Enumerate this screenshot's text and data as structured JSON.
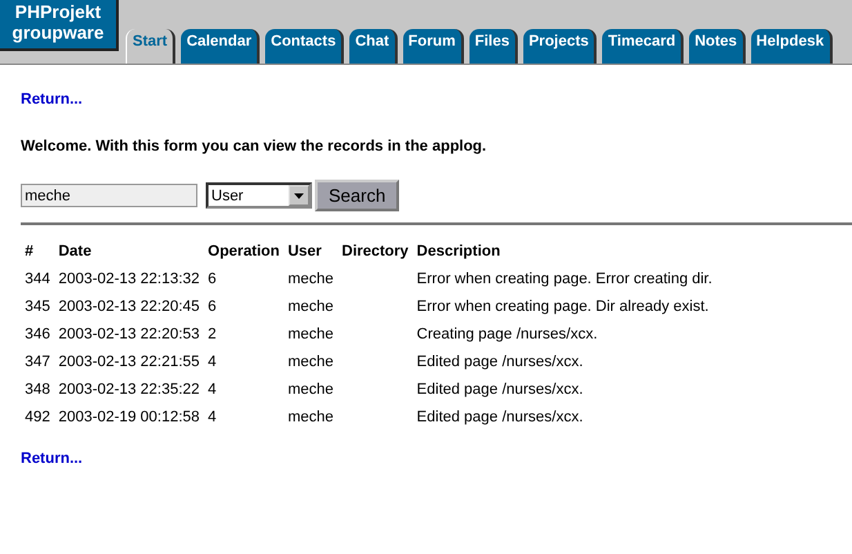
{
  "logo": {
    "lines": [
      "PHProjekt",
      "groupware"
    ]
  },
  "tabs": [
    {
      "label": "Start",
      "selected": true
    },
    {
      "label": "Calendar",
      "selected": false
    },
    {
      "label": "Contacts",
      "selected": false
    },
    {
      "label": "Chat",
      "selected": false
    },
    {
      "label": "Forum",
      "selected": false
    },
    {
      "label": "Files",
      "selected": false
    },
    {
      "label": "Projects",
      "selected": false
    },
    {
      "label": "Timecard",
      "selected": false
    },
    {
      "label": "Notes",
      "selected": false
    },
    {
      "label": "Helpdesk",
      "selected": false
    }
  ],
  "return_top": "Return...",
  "intro": "Welcome. With this form you can view the records in the applog.",
  "search": {
    "value": "meche",
    "field_select": "User",
    "button": "Search"
  },
  "table": {
    "columns": [
      "#",
      "Date",
      "Operation",
      "User",
      "Directory",
      "Description"
    ],
    "rows": [
      [
        "344",
        "2003-02-13 22:13:32",
        "6",
        "meche",
        "",
        "Error when creating page. Error creating dir."
      ],
      [
        "345",
        "2003-02-13 22:20:45",
        "6",
        "meche",
        "",
        "Error when creating page. Dir already exist."
      ],
      [
        "346",
        "2003-02-13 22:20:53",
        "2",
        "meche",
        "",
        "Creating page /nurses/xcx."
      ],
      [
        "347",
        "2003-02-13 22:21:55",
        "4",
        "meche",
        "",
        "Edited page /nurses/xcx."
      ],
      [
        "348",
        "2003-02-13 22:35:22",
        "4",
        "meche",
        "",
        "Edited page /nurses/xcx."
      ],
      [
        "492",
        "2003-02-19 00:12:58",
        "4",
        "meche",
        "",
        "Edited page /nurses/xcx."
      ]
    ]
  },
  "return_bottom": "Return..."
}
